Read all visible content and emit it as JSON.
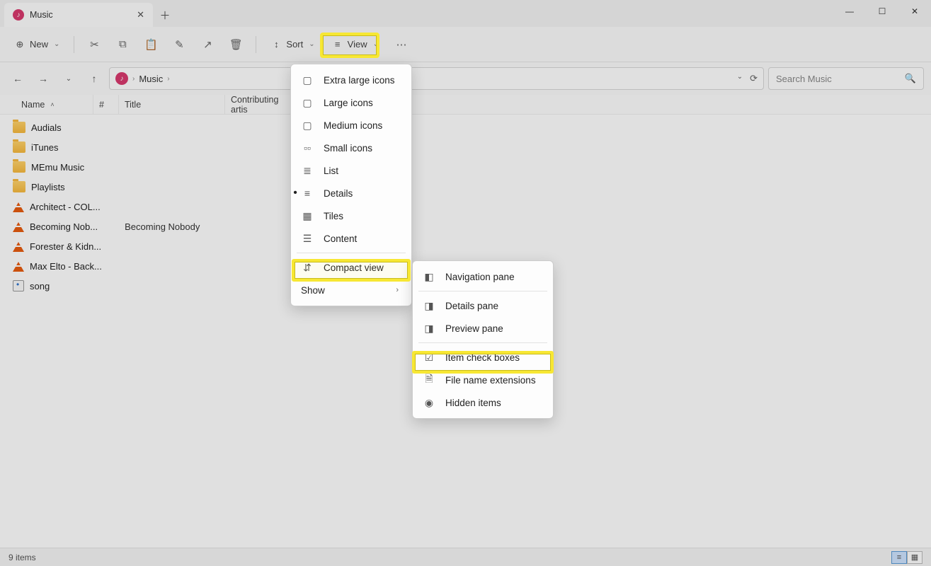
{
  "tab": {
    "title": "Music"
  },
  "toolbar": {
    "new": "New",
    "sort": "Sort",
    "view": "View"
  },
  "breadcrumb": {
    "root": "Music"
  },
  "search": {
    "placeholder": "Search Music"
  },
  "columns": {
    "name": "Name",
    "num": "#",
    "title": "Title",
    "artist": "Contributing artis"
  },
  "files": [
    {
      "type": "folder",
      "name": "Audials"
    },
    {
      "type": "folder",
      "name": "iTunes"
    },
    {
      "type": "folder",
      "name": "MEmu Music"
    },
    {
      "type": "folder",
      "name": "Playlists"
    },
    {
      "type": "vlc",
      "name": "Architect - COL..."
    },
    {
      "type": "vlc",
      "name": "Becoming Nob...",
      "title": "Becoming Nobody"
    },
    {
      "type": "vlc",
      "name": "Forester & Kidn..."
    },
    {
      "type": "vlc",
      "name": "Max Elto - Back..."
    },
    {
      "type": "aud",
      "name": "song"
    }
  ],
  "status": {
    "count": "9 items"
  },
  "viewMenu": {
    "extraLarge": "Extra large icons",
    "large": "Large icons",
    "medium": "Medium icons",
    "small": "Small icons",
    "list": "List",
    "details": "Details",
    "tiles": "Tiles",
    "content": "Content",
    "compact": "Compact view",
    "show": "Show"
  },
  "showMenu": {
    "navPane": "Navigation pane",
    "detailsPane": "Details pane",
    "previewPane": "Preview pane",
    "checkBoxes": "Item check boxes",
    "extensions": "File name extensions",
    "hidden": "Hidden items"
  }
}
